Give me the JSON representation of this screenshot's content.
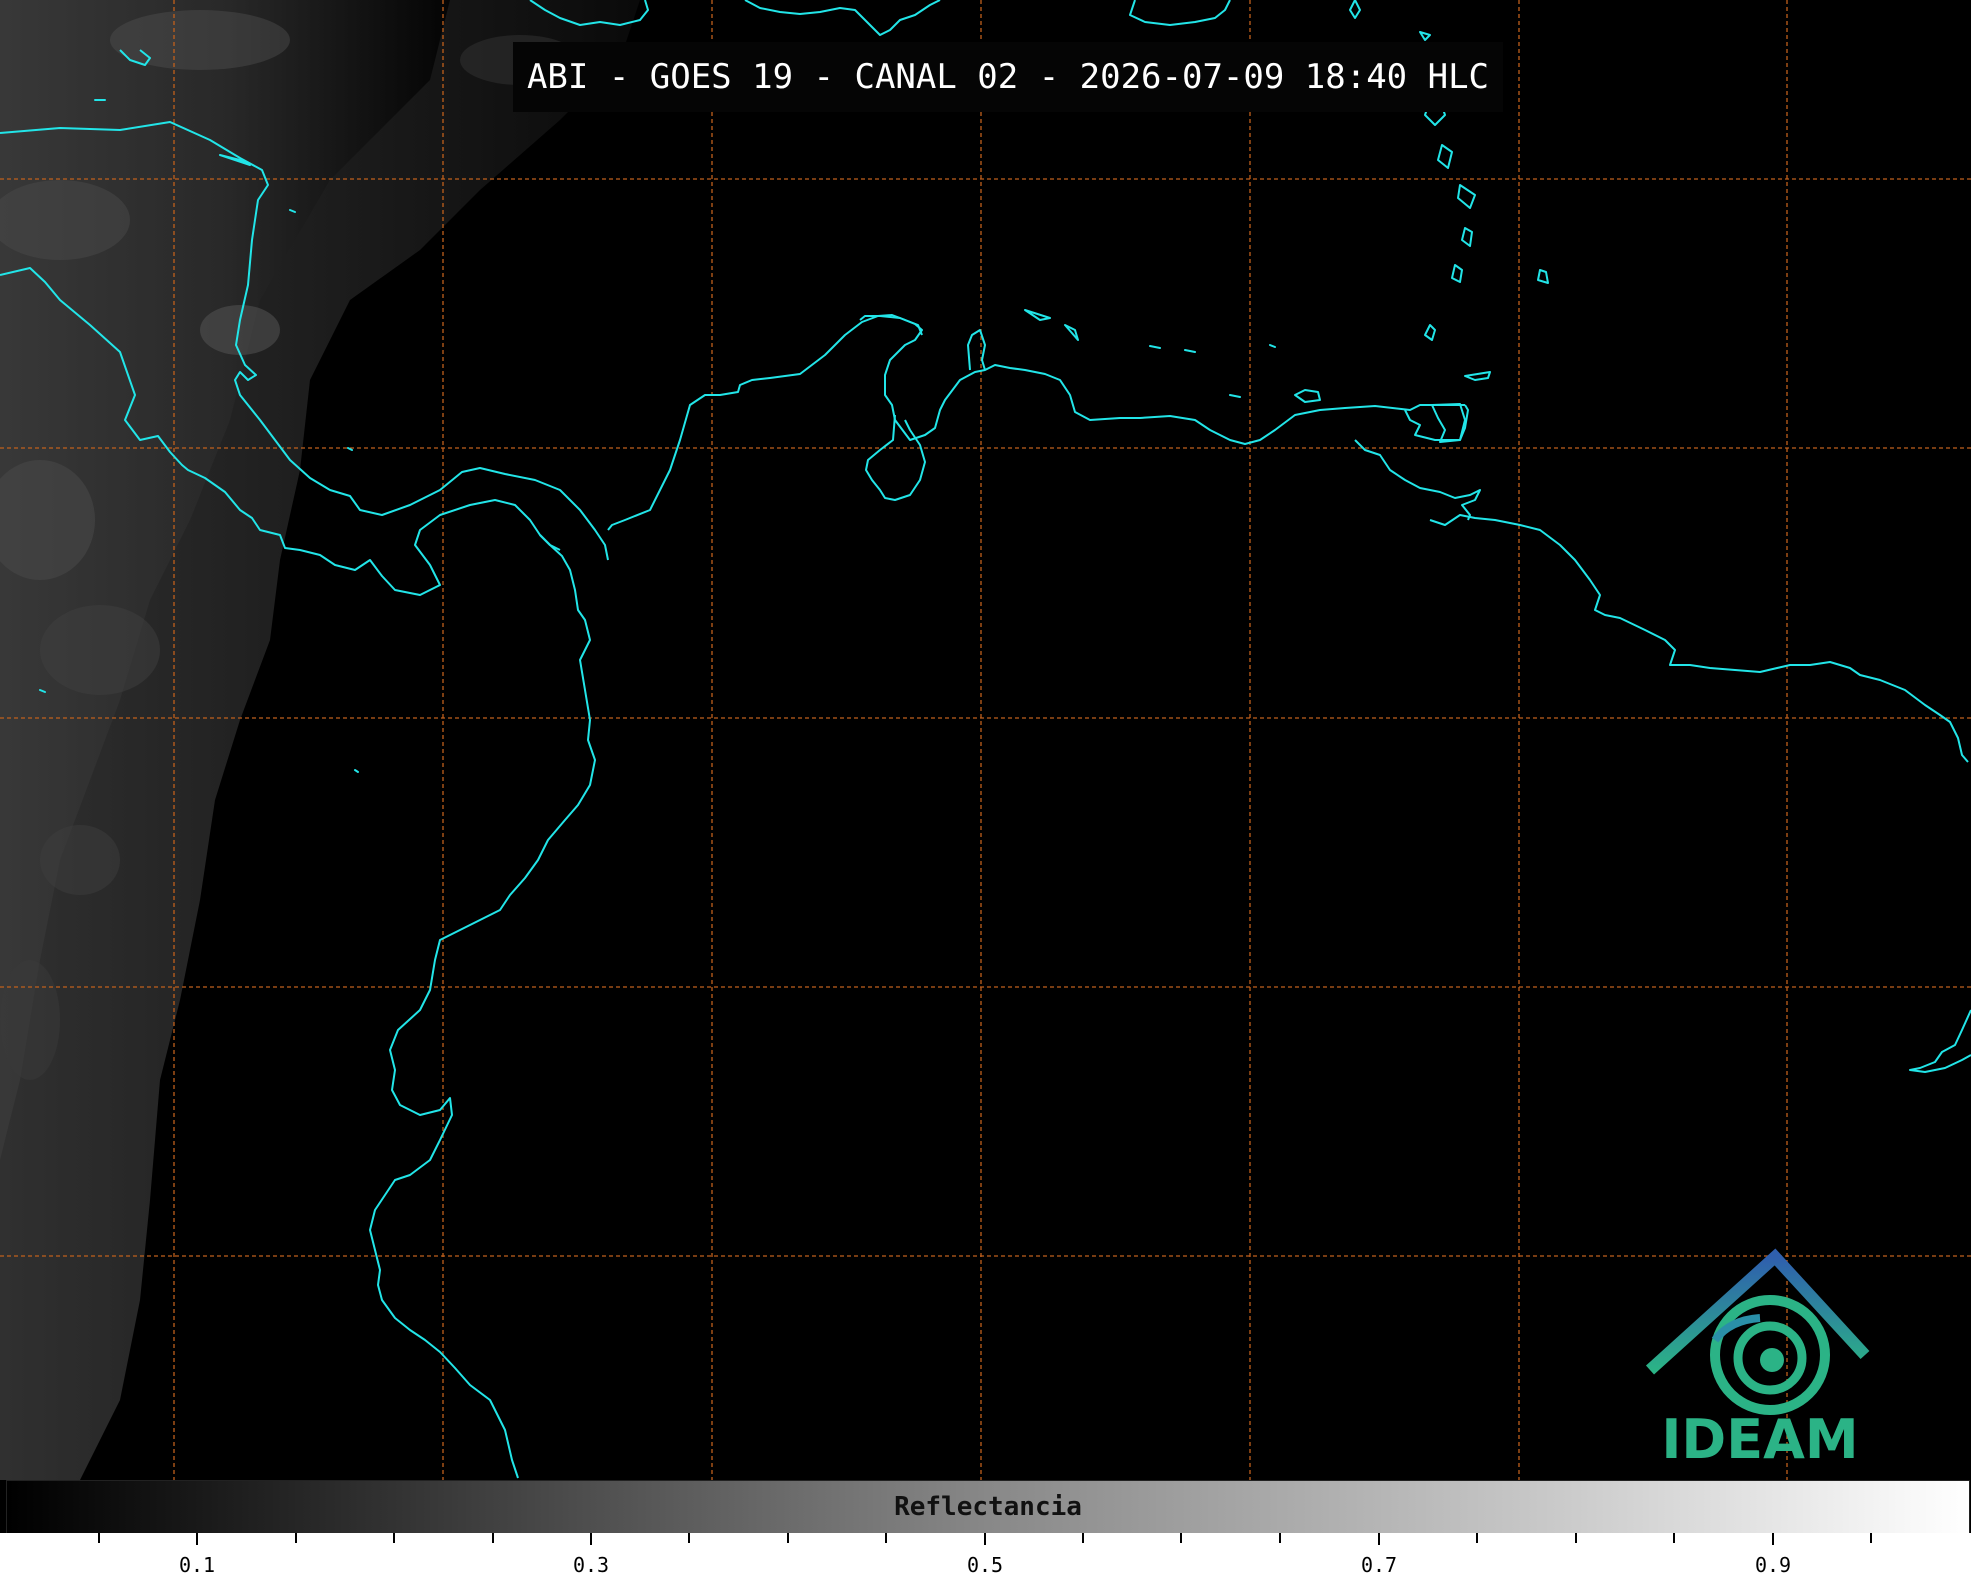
{
  "title": "ABI - GOES 19 - CANAL 02 - 2026-07-09 18:40 HLC",
  "logo": {
    "text": "IDEAM"
  },
  "colorbar": {
    "label": "Reflectancia",
    "ticks": [
      "0.1",
      "0.3",
      "0.5",
      "0.7",
      "0.9"
    ],
    "range": [
      0,
      1
    ]
  },
  "colors": {
    "coastline": "#22e5e8",
    "graticule": "#c0601c",
    "background": "#000000",
    "logo_blue": "#2f6fb5",
    "logo_green": "#2bb386"
  },
  "icons": {
    "logo": "ideam-roof-swirl-logo"
  }
}
